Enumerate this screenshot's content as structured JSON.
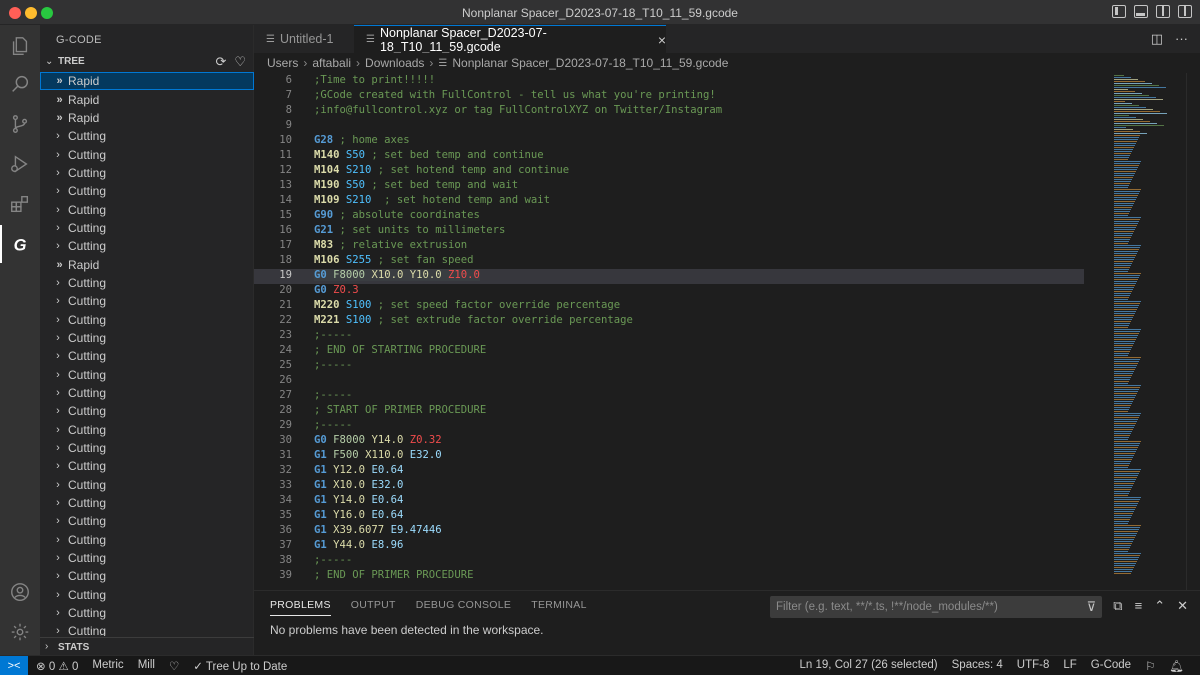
{
  "window": {
    "title": "Nonplanar Spacer_D2023-07-18_T10_11_59.gcode"
  },
  "sidebar": {
    "title": "G-CODE",
    "tree_label": "TREE",
    "stats_label": "STATS",
    "items": [
      {
        "kind": "rapid",
        "label": "Rapid"
      },
      {
        "kind": "rapid",
        "label": "Rapid"
      },
      {
        "kind": "rapid",
        "label": "Rapid"
      },
      {
        "kind": "cutting",
        "label": "Cutting"
      },
      {
        "kind": "cutting",
        "label": "Cutting"
      },
      {
        "kind": "cutting",
        "label": "Cutting"
      },
      {
        "kind": "cutting",
        "label": "Cutting"
      },
      {
        "kind": "cutting",
        "label": "Cutting"
      },
      {
        "kind": "cutting",
        "label": "Cutting"
      },
      {
        "kind": "cutting",
        "label": "Cutting"
      },
      {
        "kind": "rapid",
        "label": "Rapid"
      },
      {
        "kind": "cutting",
        "label": "Cutting"
      },
      {
        "kind": "cutting",
        "label": "Cutting"
      },
      {
        "kind": "cutting",
        "label": "Cutting"
      },
      {
        "kind": "cutting",
        "label": "Cutting"
      },
      {
        "kind": "cutting",
        "label": "Cutting"
      },
      {
        "kind": "cutting",
        "label": "Cutting"
      },
      {
        "kind": "cutting",
        "label": "Cutting"
      },
      {
        "kind": "cutting",
        "label": "Cutting"
      },
      {
        "kind": "cutting",
        "label": "Cutting"
      },
      {
        "kind": "cutting",
        "label": "Cutting"
      },
      {
        "kind": "cutting",
        "label": "Cutting"
      },
      {
        "kind": "cutting",
        "label": "Cutting"
      },
      {
        "kind": "cutting",
        "label": "Cutting"
      },
      {
        "kind": "cutting",
        "label": "Cutting"
      },
      {
        "kind": "cutting",
        "label": "Cutting"
      },
      {
        "kind": "cutting",
        "label": "Cutting"
      },
      {
        "kind": "cutting",
        "label": "Cutting"
      },
      {
        "kind": "cutting",
        "label": "Cutting"
      },
      {
        "kind": "cutting",
        "label": "Cutting"
      },
      {
        "kind": "cutting",
        "label": "Cutting"
      }
    ]
  },
  "tabs": [
    {
      "label": "Untitled-1",
      "active": false
    },
    {
      "label": "Nonplanar Spacer_D2023-07-18_T10_11_59.gcode",
      "active": true
    }
  ],
  "breadcrumb": [
    "Users",
    "aftabali",
    "Downloads",
    "Nonplanar Spacer_D2023-07-18_T10_11_59.gcode"
  ],
  "editor": {
    "current_line": 19,
    "lines": [
      {
        "n": "6",
        "tokens": [
          [
            "cmt",
            ";Time to print!!!!!"
          ]
        ]
      },
      {
        "n": "7",
        "tokens": [
          [
            "cmt",
            ";GCode created with FullControl - tell us what you're printing!"
          ]
        ]
      },
      {
        "n": "8",
        "tokens": [
          [
            "cmt",
            ";info@fullcontrol.xyz or tag FullControlXYZ on Twitter/Instagram"
          ]
        ]
      },
      {
        "n": "9",
        "tokens": []
      },
      {
        "n": "10",
        "tokens": [
          [
            "g",
            "G28"
          ],
          [
            "cmt",
            " ; home axes"
          ]
        ]
      },
      {
        "n": "11",
        "tokens": [
          [
            "m",
            "M140"
          ],
          [
            "plain",
            " "
          ],
          [
            "s",
            "S50"
          ],
          [
            "cmt",
            " ; set bed temp and continue"
          ]
        ]
      },
      {
        "n": "12",
        "tokens": [
          [
            "m",
            "M104"
          ],
          [
            "plain",
            " "
          ],
          [
            "s",
            "S210"
          ],
          [
            "cmt",
            " ; set hotend temp and continue"
          ]
        ]
      },
      {
        "n": "13",
        "tokens": [
          [
            "m",
            "M190"
          ],
          [
            "plain",
            " "
          ],
          [
            "s",
            "S50"
          ],
          [
            "cmt",
            " ; set bed temp and wait"
          ]
        ]
      },
      {
        "n": "14",
        "tokens": [
          [
            "m",
            "M109"
          ],
          [
            "plain",
            " "
          ],
          [
            "s",
            "S210"
          ],
          [
            "cmt",
            "  ; set hotend temp and wait"
          ]
        ]
      },
      {
        "n": "15",
        "tokens": [
          [
            "g",
            "G90"
          ],
          [
            "cmt",
            " ; absolute coordinates"
          ]
        ]
      },
      {
        "n": "16",
        "tokens": [
          [
            "g",
            "G21"
          ],
          [
            "cmt",
            " ; set units to millimeters"
          ]
        ]
      },
      {
        "n": "17",
        "tokens": [
          [
            "m",
            "M83"
          ],
          [
            "cmt",
            " ; relative extrusion"
          ]
        ]
      },
      {
        "n": "18",
        "tokens": [
          [
            "m",
            "M106"
          ],
          [
            "plain",
            " "
          ],
          [
            "s",
            "S255"
          ],
          [
            "cmt",
            " ; set fan speed"
          ]
        ]
      },
      {
        "n": "19",
        "tokens": [
          [
            "g",
            "G0"
          ],
          [
            "plain",
            " "
          ],
          [
            "f",
            "F8000"
          ],
          [
            "plain",
            " "
          ],
          [
            "x",
            "X10.0"
          ],
          [
            "plain",
            " "
          ],
          [
            "y",
            "Y10.0"
          ],
          [
            "plain",
            " "
          ],
          [
            "z",
            "Z10.0"
          ]
        ]
      },
      {
        "n": "20",
        "tokens": [
          [
            "g",
            "G0"
          ],
          [
            "plain",
            " "
          ],
          [
            "z",
            "Z0.3"
          ]
        ]
      },
      {
        "n": "21",
        "tokens": [
          [
            "m",
            "M220"
          ],
          [
            "plain",
            " "
          ],
          [
            "s",
            "S100"
          ],
          [
            "cmt",
            " ; set speed factor override percentage"
          ]
        ]
      },
      {
        "n": "22",
        "tokens": [
          [
            "m",
            "M221"
          ],
          [
            "plain",
            " "
          ],
          [
            "s",
            "S100"
          ],
          [
            "cmt",
            " ; set extrude factor override percentage"
          ]
        ]
      },
      {
        "n": "23",
        "tokens": [
          [
            "cmt",
            ";-----"
          ]
        ]
      },
      {
        "n": "24",
        "tokens": [
          [
            "cmt",
            "; END OF STARTING PROCEDURE"
          ]
        ]
      },
      {
        "n": "25",
        "tokens": [
          [
            "cmt",
            ";-----"
          ]
        ]
      },
      {
        "n": "26",
        "tokens": []
      },
      {
        "n": "27",
        "tokens": [
          [
            "cmt",
            ";-----"
          ]
        ]
      },
      {
        "n": "28",
        "tokens": [
          [
            "cmt",
            "; START OF PRIMER PROCEDURE"
          ]
        ]
      },
      {
        "n": "29",
        "tokens": [
          [
            "cmt",
            ";-----"
          ]
        ]
      },
      {
        "n": "30",
        "tokens": [
          [
            "g",
            "G0"
          ],
          [
            "plain",
            " "
          ],
          [
            "f",
            "F8000"
          ],
          [
            "plain",
            " "
          ],
          [
            "y",
            "Y14.0"
          ],
          [
            "plain",
            " "
          ],
          [
            "z",
            "Z0.32"
          ]
        ]
      },
      {
        "n": "31",
        "tokens": [
          [
            "g",
            "G1"
          ],
          [
            "plain",
            " "
          ],
          [
            "f",
            "F500"
          ],
          [
            "plain",
            " "
          ],
          [
            "x",
            "X110.0"
          ],
          [
            "plain",
            " "
          ],
          [
            "e",
            "E32.0"
          ]
        ]
      },
      {
        "n": "32",
        "tokens": [
          [
            "g",
            "G1"
          ],
          [
            "plain",
            " "
          ],
          [
            "y",
            "Y12.0"
          ],
          [
            "plain",
            " "
          ],
          [
            "e",
            "E0.64"
          ]
        ]
      },
      {
        "n": "33",
        "tokens": [
          [
            "g",
            "G1"
          ],
          [
            "plain",
            " "
          ],
          [
            "x",
            "X10.0"
          ],
          [
            "plain",
            " "
          ],
          [
            "e",
            "E32.0"
          ]
        ]
      },
      {
        "n": "34",
        "tokens": [
          [
            "g",
            "G1"
          ],
          [
            "plain",
            " "
          ],
          [
            "y",
            "Y14.0"
          ],
          [
            "plain",
            " "
          ],
          [
            "e",
            "E0.64"
          ]
        ]
      },
      {
        "n": "35",
        "tokens": [
          [
            "g",
            "G1"
          ],
          [
            "plain",
            " "
          ],
          [
            "y",
            "Y16.0"
          ],
          [
            "plain",
            " "
          ],
          [
            "e",
            "E0.64"
          ]
        ]
      },
      {
        "n": "36",
        "tokens": [
          [
            "g",
            "G1"
          ],
          [
            "plain",
            " "
          ],
          [
            "x",
            "X39.6077"
          ],
          [
            "plain",
            " "
          ],
          [
            "e",
            "E9.47446"
          ]
        ]
      },
      {
        "n": "37",
        "tokens": [
          [
            "g",
            "G1"
          ],
          [
            "plain",
            " "
          ],
          [
            "y",
            "Y44.0"
          ],
          [
            "plain",
            " "
          ],
          [
            "e",
            "E8.96"
          ]
        ]
      },
      {
        "n": "38",
        "tokens": [
          [
            "cmt",
            ";-----"
          ]
        ]
      },
      {
        "n": "39",
        "tokens": [
          [
            "cmt",
            "; END OF PRIMER PROCEDURE"
          ]
        ]
      }
    ]
  },
  "panel": {
    "tabs": [
      "PROBLEMS",
      "OUTPUT",
      "DEBUG CONSOLE",
      "TERMINAL"
    ],
    "active_tab": "PROBLEMS",
    "filter_placeholder": "Filter (e.g. text, **/*.ts, !**/node_modules/**)",
    "message": "No problems have been detected in the workspace."
  },
  "statusbar": {
    "remote_icon": "><",
    "errors": "0",
    "warnings": "0",
    "units": "Metric",
    "mode": "Mill",
    "tree_status": "Tree Up to Date",
    "position": "Ln 19, Col 27 (26 selected)",
    "spaces": "Spaces: 4",
    "encoding": "UTF-8",
    "eol": "LF",
    "language": "G-Code"
  },
  "colors": {
    "accent": "#0078d4",
    "comment": "#6a9955",
    "g_command": "#569cd6",
    "m_command": "#dcdcaa",
    "z_param": "#f14c4c",
    "e_param": "#9cdcfe",
    "s_param": "#4fc1ff"
  }
}
